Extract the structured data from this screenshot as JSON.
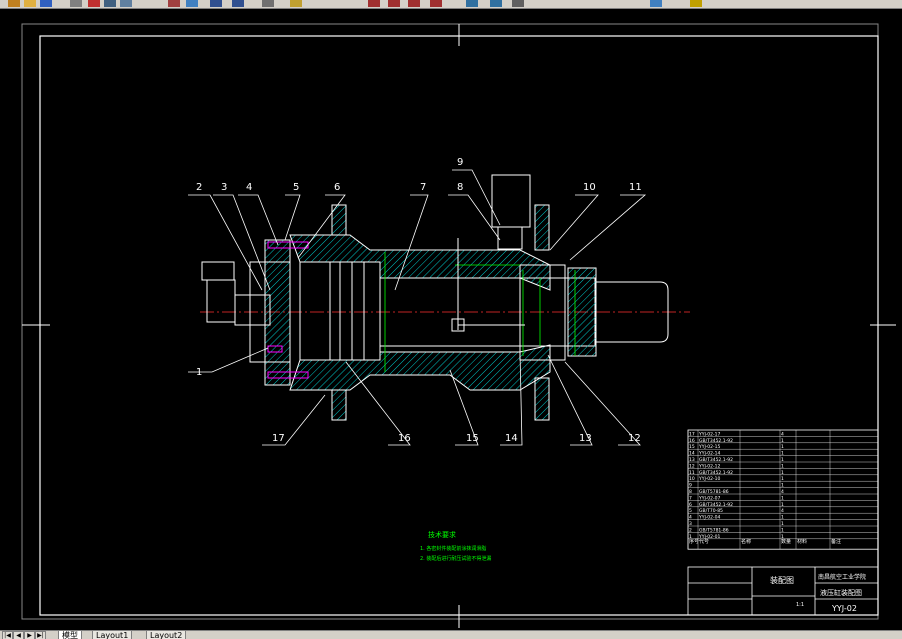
{
  "tabs": {
    "model": "模型",
    "layout1": "Layout1",
    "layout2": "Layout2"
  },
  "toolbar": {
    "icons": [
      "arrow-icon",
      "folder-open-icon",
      "save-icon",
      "print-icon",
      "cut-icon",
      "copy-icon",
      "paste-icon",
      "zoom-icon",
      "pan-icon",
      "undo-icon",
      "redo-icon",
      "properties-icon",
      "layer-icon",
      "zoom-window-icon",
      "zoom-prev-icon",
      "zoom-realtime-icon",
      "zoom-extents-icon",
      "dimension-icon",
      "text-icon",
      "table-icon",
      "layers-icon",
      "color-icon"
    ]
  },
  "drawing": {
    "part_numbers": [
      "1",
      "2",
      "3",
      "4",
      "5",
      "6",
      "7",
      "8",
      "9",
      "10",
      "11",
      "12",
      "13",
      "14",
      "15",
      "16",
      "17"
    ],
    "tech_title": "技术要求",
    "tech_lines": [
      "1. 各密封件装配前涂抹润滑脂",
      "2. 装配后进行耐压试验不得泄漏"
    ],
    "title_block": {
      "drawing_name": "液压缸装配图",
      "school": "南昌航空工业学院",
      "drawing_no": "YYJ-02",
      "scale": "1:1",
      "sheet_label": "装配图"
    },
    "bom_headers": [
      "序号",
      "代号",
      "名称",
      "数量",
      "材料",
      "备注"
    ],
    "bom_rows": [
      [
        "17",
        "YYJ-02-17",
        "",
        "4",
        "",
        ""
      ],
      [
        "16",
        "GB/T3452.1-92",
        "",
        "1",
        "",
        ""
      ],
      [
        "15",
        "YYJ-02-15",
        "",
        "1",
        "",
        ""
      ],
      [
        "14",
        "YYJ-02-14",
        "",
        "1",
        "",
        ""
      ],
      [
        "13",
        "GB/T3452.1-92",
        "",
        "1",
        "",
        ""
      ],
      [
        "12",
        "YYJ-02-12",
        "",
        "1",
        "",
        ""
      ],
      [
        "11",
        "GB/T3452.1-92",
        "",
        "1",
        "",
        ""
      ],
      [
        "10",
        "YYJ-02-10",
        "",
        "1",
        "",
        ""
      ],
      [
        "9",
        "",
        "",
        "1",
        "",
        ""
      ],
      [
        "8",
        "GB/T5781-86",
        "",
        "4",
        "",
        ""
      ],
      [
        "7",
        "YYJ-02-07",
        "",
        "1",
        "",
        ""
      ],
      [
        "6",
        "GB/T3452.1-92",
        "",
        "1",
        "",
        ""
      ],
      [
        "5",
        "GB/T70-85",
        "",
        "4",
        "",
        ""
      ],
      [
        "4",
        "YYJ-02-04",
        "",
        "1",
        "",
        ""
      ],
      [
        "3",
        "",
        "",
        "1",
        "",
        ""
      ],
      [
        "2",
        "GB/T5781-86",
        "",
        "1",
        "",
        ""
      ],
      [
        "1",
        "YYJ-02-01",
        "",
        "1",
        "",
        ""
      ]
    ],
    "colors": {
      "frame": "#ffffff",
      "hatch": "#00c8c8",
      "center": "#ff3030",
      "dim": "#00ff00",
      "tech": "#00ff00",
      "bolt": "#ff00ff"
    }
  }
}
